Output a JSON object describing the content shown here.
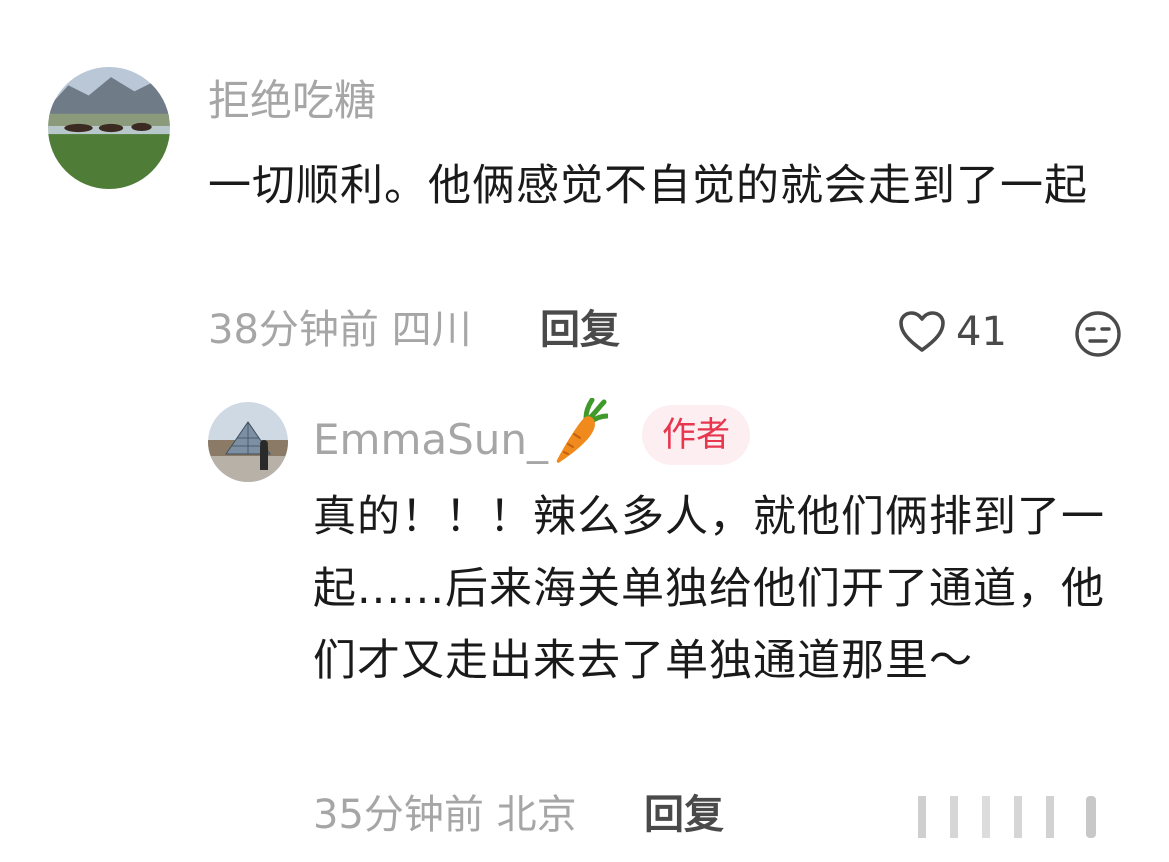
{
  "comment": {
    "username": "拒绝吃糖",
    "text": "一切顺利。他俩感觉不自觉的就会走到了一起",
    "time": "38分钟前",
    "location": "四川",
    "reply_label": "回复",
    "like_count": "41",
    "icons": {
      "like": "heart-outline-icon",
      "dislike": "unamused-face-icon"
    }
  },
  "reply": {
    "username": "EmmaSun_",
    "username_emoji": "carrot-icon",
    "badge": "作者",
    "text": "真的！！！辣么多人，就他们俩排到了一起......后来海关单独给他们开了通道，他们才又走出来去了单独通道那里～",
    "time": "35分钟前",
    "location": "北京",
    "reply_label": "回复"
  },
  "colors": {
    "meta_gray": "#a6a6a6",
    "body_text": "#1a1a1a",
    "badge_bg": "#fdeef1",
    "badge_text": "#e8364f",
    "action_dark": "#4a4a4a"
  }
}
